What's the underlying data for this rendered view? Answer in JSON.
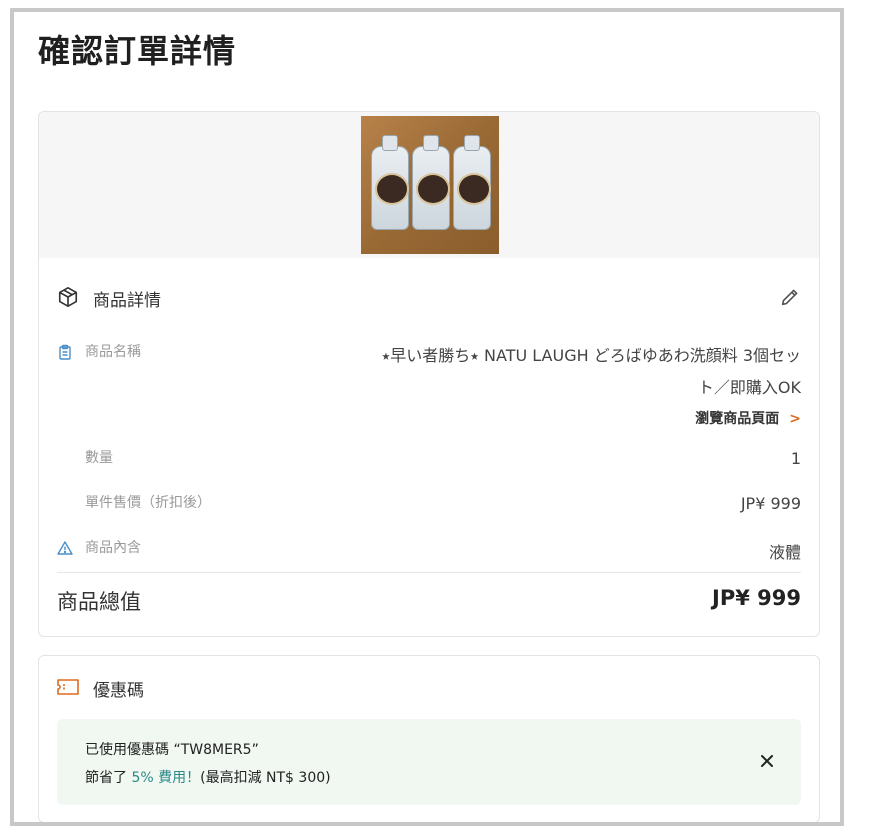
{
  "page": {
    "title": "確認訂單詳情"
  },
  "product": {
    "section_title": "商品詳情",
    "name_label": "商品名稱",
    "name_value": "⭑早い者勝ち⭑ NATU LAUGH どろばゆあわ洗顔料 3個セット／即購入OK",
    "view_link_label": "瀏覽商品頁面",
    "quantity_label": "數量",
    "quantity_value": "1",
    "unit_price_label": "單件售價（折扣後）",
    "unit_price_value": "JP¥ 999",
    "contents_label": "商品內含",
    "contents_value": "液體",
    "total_label": "商品總值",
    "total_value": "JP¥ 999"
  },
  "coupon": {
    "section_title": "優惠碼",
    "applied_prefix": "已使用優惠碼",
    "code_text": "“TW8MER5”",
    "saved_prefix": "節省了",
    "saved_amount": "5% 費用！",
    "saved_note": "(最高扣減 NT$ 300)"
  },
  "colors": {
    "accent_orange": "#e06a1f",
    "icon_blue": "#4a8fc8",
    "coupon_bg": "#f1f7f1",
    "coupon_highlight": "#2a8a8a"
  },
  "icons": {
    "section": "box-icon",
    "edit": "pencil-icon",
    "name": "clipboard-icon",
    "contents": "warning-triangle-icon",
    "coupon": "ticket-icon",
    "close": "close-icon",
    "link": "chevron-right-icon"
  }
}
